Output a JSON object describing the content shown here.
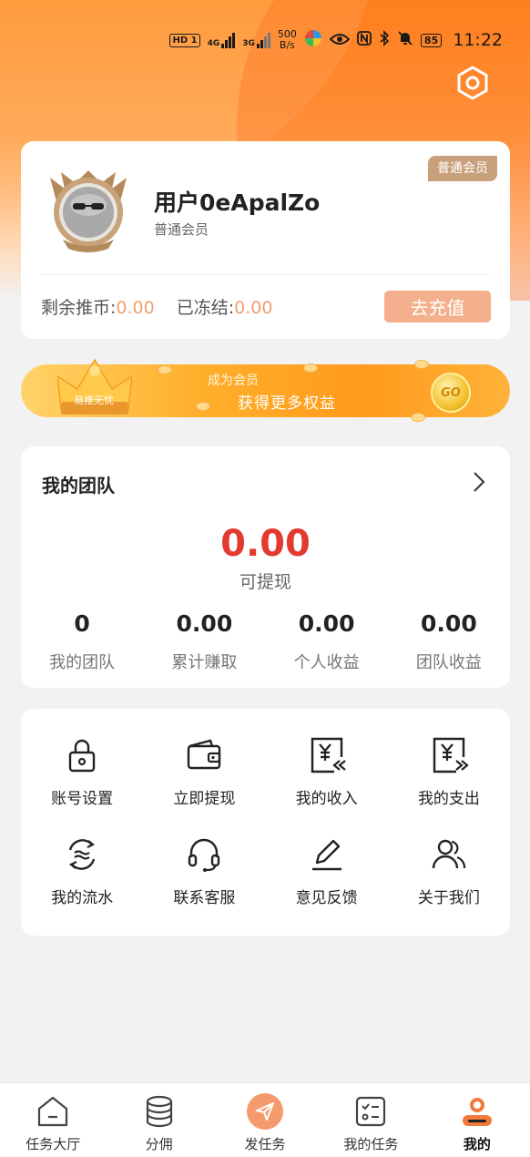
{
  "status_bar": {
    "hd_label": "HD",
    "sim1": "1",
    "net1": "4G",
    "net2": "3G",
    "speed_value": "500",
    "speed_unit": "B/s",
    "battery": "85",
    "time": "11:22"
  },
  "header": {
    "settings_icon": "hexagon-settings-icon"
  },
  "profile": {
    "member_tag": "普通会员",
    "username": "用户0eApalZo",
    "level": "普通会员",
    "balance_label": "剩余推币:",
    "balance_value": "0.00",
    "frozen_label": "已冻结:",
    "frozen_value": "0.00",
    "recharge_button": "去充值"
  },
  "vip_banner": {
    "crown_label": "易推无忧",
    "line1": "成为会员",
    "line2": "获得更多权益",
    "go_label": "GO"
  },
  "team": {
    "title": "我的团队",
    "withdrawable_amount": "0.00",
    "withdrawable_label": "可提现",
    "stats": [
      {
        "value": "0",
        "label": "我的团队"
      },
      {
        "value": "0.00",
        "label": "累计赚取"
      },
      {
        "value": "0.00",
        "label": "个人收益"
      },
      {
        "value": "0.00",
        "label": "团队收益"
      }
    ]
  },
  "menu": {
    "items": [
      {
        "label": "账号设置",
        "icon": "lock-icon"
      },
      {
        "label": "立即提现",
        "icon": "wallet-icon"
      },
      {
        "label": "我的收入",
        "icon": "income-icon"
      },
      {
        "label": "我的支出",
        "icon": "expense-icon"
      },
      {
        "label": "我的流水",
        "icon": "flow-icon"
      },
      {
        "label": "联系客服",
        "icon": "headset-icon"
      },
      {
        "label": "意见反馈",
        "icon": "edit-icon"
      },
      {
        "label": "关于我们",
        "icon": "users-icon"
      }
    ]
  },
  "tabbar": {
    "items": [
      {
        "label": "任务大厅",
        "icon": "home-icon"
      },
      {
        "label": "分佣",
        "icon": "coins-icon"
      },
      {
        "label": "发任务",
        "icon": "send-icon"
      },
      {
        "label": "我的任务",
        "icon": "checklist-icon"
      },
      {
        "label": "我的",
        "icon": "profile-icon"
      }
    ],
    "active": "我的"
  },
  "colors": {
    "accent": "#ff8a1e",
    "amount_red": "#e33a30",
    "recharge_btn": "#f4b08c",
    "member_tag": "#c9a07c"
  }
}
